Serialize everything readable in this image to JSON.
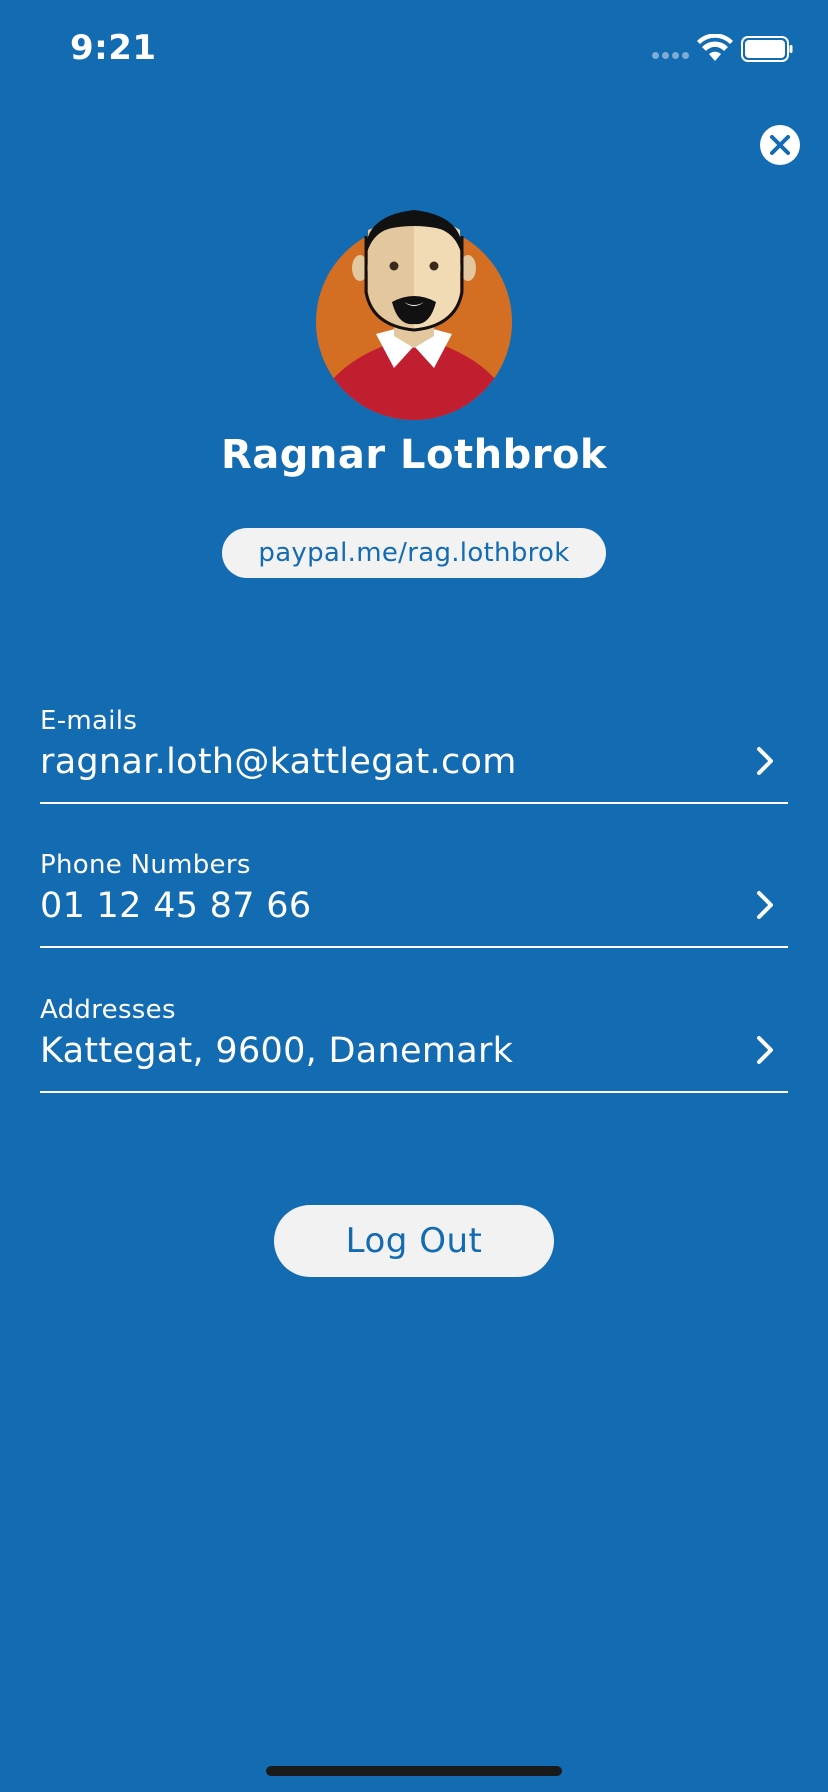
{
  "status_bar": {
    "time": "9:21"
  },
  "profile": {
    "name": "Ragnar Lothbrok",
    "paypal_link": "paypal.me/rag.lothbrok"
  },
  "rows": [
    {
      "label": "E-mails",
      "value": "ragnar.loth@kattlegat.com"
    },
    {
      "label": "Phone Numbers",
      "value": "01 12 45 87 66"
    },
    {
      "label": "Addresses",
      "value": "Kattegat, 9600, Danemark"
    }
  ],
  "actions": {
    "logout_label": "Log Out"
  },
  "colors": {
    "background": "#136bb2",
    "pill": "#f2f2f2",
    "avatar_circle": "#d46e22",
    "shirt": "#c11f2f"
  },
  "icons": {
    "close": "close-icon",
    "chevron": "chevron-right-icon",
    "wifi": "wifi-icon",
    "battery": "battery-icon"
  }
}
